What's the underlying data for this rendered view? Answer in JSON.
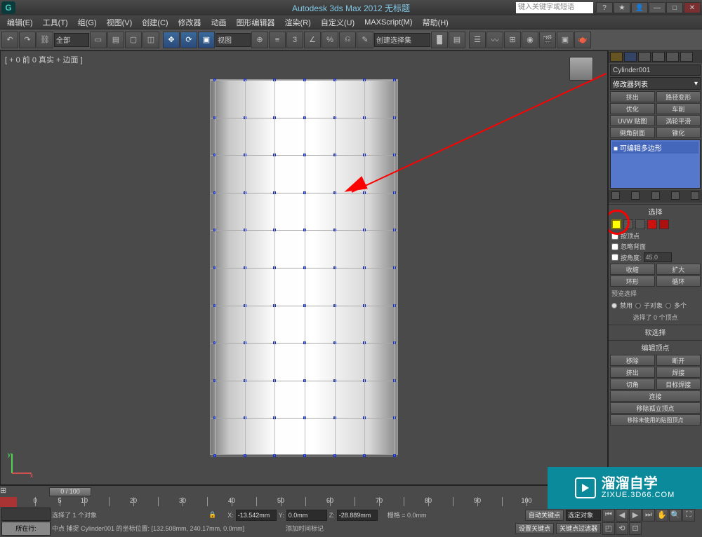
{
  "title": "Autodesk 3ds Max 2012      无标题",
  "search_placeholder": "键入关键字或短语",
  "menu": [
    "编辑(E)",
    "工具(T)",
    "组(G)",
    "视图(V)",
    "创建(C)",
    "修改器",
    "动画",
    "图形编辑器",
    "渲染(R)",
    "自定义(U)",
    "MAXScript(M)",
    "帮助(H)"
  ],
  "toolbar": {
    "select_filter": "全部",
    "ref_coord": "视图",
    "named_sel": "创建选择集"
  },
  "viewport": {
    "label": "[ + 0 前 0 真实 + 边面 ]"
  },
  "side": {
    "object_name": "Cylinder001",
    "modifier_dd": "修改器列表",
    "btn_rows": [
      [
        "挤出",
        "路径变形"
      ],
      [
        "优化",
        "车削"
      ],
      [
        "UVW 贴图",
        "涡轮平滑"
      ],
      [
        "倒角剖面",
        "锥化"
      ]
    ],
    "stack_item": "■ 可编辑多边形",
    "sel_title": "选择",
    "by_vertex": "按顶点",
    "ignore_back": "忽略背面",
    "by_angle": "按角度:",
    "angle_val": "45.0",
    "shrink": "收缩",
    "grow": "扩大",
    "ring": "环形",
    "loop": "循环",
    "preview_sel": "预览选择",
    "r_disable": "禁用",
    "r_subobj": "子对象",
    "r_multi": "多个",
    "sel_status": "选择了 0 个顶点",
    "soft_sel": "软选择",
    "edit_vert": "编辑顶点",
    "remove": "移除",
    "break_v": "断开",
    "extrude": "挤出",
    "weld": "焊接",
    "chamfer": "切角",
    "target_weld": "目标焊接",
    "connect": "连接",
    "rm_iso": "移除孤立顶点",
    "rm_unused": "移除未使用的贴图顶点"
  },
  "timeline": {
    "frame": "0 / 100"
  },
  "status": {
    "row_btn": "所在行:",
    "sel_info": "选择了 1 个对象",
    "snap_info": "中点 捕捉 Cylinder001 的坐标位置: [132.508mm, 240.17mm, 0.0mm]",
    "x_lbl": "X:",
    "x_val": "-13.542mm",
    "y_lbl": "Y:",
    "y_val": "0.0mm",
    "z_lbl": "Z:",
    "z_val": "-28.889mm",
    "grid_lbl": "栅格 = 0.0mm",
    "autokey": "自动关键点",
    "selset": "选定对象",
    "setkey": "设置关键点",
    "keyfilter": "关键点过滤器",
    "addtime": "添加时间标记"
  },
  "watermark": {
    "cn": "溜溜自学",
    "en": "ZIXUE.3D66.COM"
  }
}
